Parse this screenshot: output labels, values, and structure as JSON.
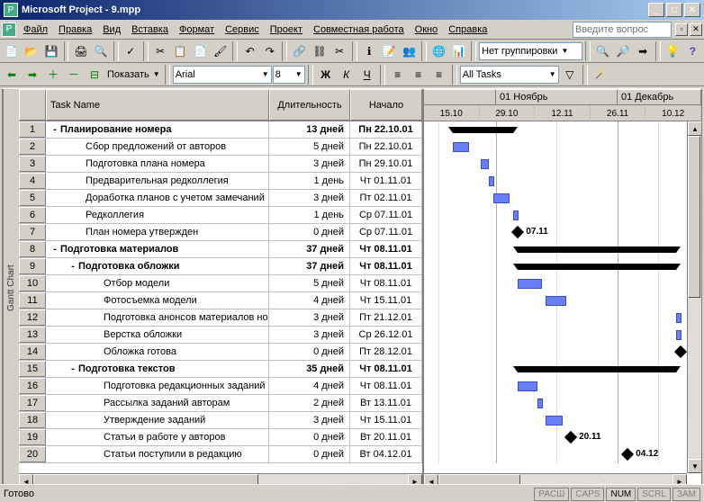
{
  "titlebar": {
    "app": "Microsoft Project",
    "file": "9.mpp"
  },
  "menu": {
    "file": "Файл",
    "edit": "Правка",
    "view": "Вид",
    "insert": "Вставка",
    "format": "Формат",
    "tools": "Сервис",
    "project": "Проект",
    "collab": "Совместная работа",
    "window": "Окно",
    "help": "Справка"
  },
  "question_placeholder": "Введите вопрос",
  "toolbar2": {
    "show_label": "Показать",
    "font": "Arial",
    "size": "8",
    "grouping": "Нет группировки",
    "filter": "All Tasks"
  },
  "view_name": "Gantt Chart",
  "columns": {
    "name": "Task Name",
    "duration": "Длительность",
    "start": "Начало"
  },
  "timeline": {
    "months": [
      "01 Ноябрь",
      "01 Декабрь"
    ],
    "days": [
      "15.10",
      "29.10",
      "12.11",
      "26.11",
      "10.12"
    ]
  },
  "tasks": [
    {
      "id": 1,
      "name": "Планирование номера",
      "dur": "13 дней",
      "start": "Пн 22.10.01",
      "type": "summary",
      "level": 0
    },
    {
      "id": 2,
      "name": "Сбор предложений от авторов",
      "dur": "5 дней",
      "start": "Пн 22.10.01",
      "type": "task",
      "level": 1
    },
    {
      "id": 3,
      "name": "Подготовка плана номера",
      "dur": "3 дней",
      "start": "Пн 29.10.01",
      "type": "task",
      "level": 1
    },
    {
      "id": 4,
      "name": "Предварительная редколлегия",
      "dur": "1 день",
      "start": "Чт 01.11.01",
      "type": "task",
      "level": 1
    },
    {
      "id": 5,
      "name": "Доработка планов с учетом замечаний",
      "dur": "3 дней",
      "start": "Пт 02.11.01",
      "type": "task",
      "level": 1
    },
    {
      "id": 6,
      "name": "Редколлегия",
      "dur": "1 день",
      "start": "Ср 07.11.01",
      "type": "task",
      "level": 1
    },
    {
      "id": 7,
      "name": "План номера утвержден",
      "dur": "0 дней",
      "start": "Ср 07.11.01",
      "type": "milestone",
      "level": 1,
      "label": "07.11"
    },
    {
      "id": 8,
      "name": "Подготовка материалов",
      "dur": "37 дней",
      "start": "Чт 08.11.01",
      "type": "summary",
      "level": 0
    },
    {
      "id": 9,
      "name": "Подготовка обложки",
      "dur": "37 дней",
      "start": "Чт 08.11.01",
      "type": "summary",
      "level": 1
    },
    {
      "id": 10,
      "name": "Отбор модели",
      "dur": "5 дней",
      "start": "Чт 08.11.01",
      "type": "task",
      "level": 2
    },
    {
      "id": 11,
      "name": "Фотосъемка модели",
      "dur": "4 дней",
      "start": "Чт 15.11.01",
      "type": "task",
      "level": 2
    },
    {
      "id": 12,
      "name": "Подготовка анонсов материалов номера для",
      "dur": "3 дней",
      "start": "Пт 21.12.01",
      "type": "task",
      "level": 2
    },
    {
      "id": 13,
      "name": "Верстка обложки",
      "dur": "3 дней",
      "start": "Ср 26.12.01",
      "type": "task",
      "level": 2
    },
    {
      "id": 14,
      "name": "Обложка готова",
      "dur": "0 дней",
      "start": "Пт 28.12.01",
      "type": "milestone",
      "level": 2
    },
    {
      "id": 15,
      "name": "Подготовка текстов",
      "dur": "35 дней",
      "start": "Чт 08.11.01",
      "type": "summary",
      "level": 1
    },
    {
      "id": 16,
      "name": "Подготовка редакционных заданий",
      "dur": "4 дней",
      "start": "Чт 08.11.01",
      "type": "task",
      "level": 2
    },
    {
      "id": 17,
      "name": "Рассылка заданий авторам",
      "dur": "2 дней",
      "start": "Вт 13.11.01",
      "type": "task",
      "level": 2
    },
    {
      "id": 18,
      "name": "Утверждение заданий",
      "dur": "3 дней",
      "start": "Чт 15.11.01",
      "type": "task",
      "level": 2
    },
    {
      "id": 19,
      "name": "Статьи в работе у авторов",
      "dur": "0 дней",
      "start": "Вт 20.11.01",
      "type": "milestone",
      "level": 2,
      "label": "20.11"
    },
    {
      "id": 20,
      "name": "Статьи поступили в редакцию",
      "dur": "0 дней",
      "start": "Вт 04.12.01",
      "type": "milestone",
      "level": 2,
      "label": "04.12"
    }
  ],
  "status": {
    "ready": "Готово",
    "cells": [
      "РАСШ",
      "CAPS",
      "NUM",
      "SCRL",
      "ЗАМ"
    ],
    "active": "NUM"
  },
  "chart_data": {
    "type": "gantt",
    "time_axis_start": "15.10.2001",
    "time_axis_end": "17.12.2001",
    "bars": [
      {
        "task_id": 1,
        "start": "22.10.01",
        "end": "07.11.01",
        "kind": "summary"
      },
      {
        "task_id": 2,
        "start": "22.10.01",
        "end": "26.10.01",
        "kind": "bar"
      },
      {
        "task_id": 3,
        "start": "29.10.01",
        "end": "31.10.01",
        "kind": "bar"
      },
      {
        "task_id": 4,
        "start": "01.11.01",
        "end": "01.11.01",
        "kind": "bar"
      },
      {
        "task_id": 5,
        "start": "02.11.01",
        "end": "06.11.01",
        "kind": "bar"
      },
      {
        "task_id": 6,
        "start": "07.11.01",
        "end": "07.11.01",
        "kind": "bar"
      },
      {
        "task_id": 7,
        "start": "07.11.01",
        "kind": "milestone",
        "label": "07.11"
      },
      {
        "task_id": 8,
        "start": "08.11.01",
        "end": "28.12.01",
        "kind": "summary"
      },
      {
        "task_id": 9,
        "start": "08.11.01",
        "end": "28.12.01",
        "kind": "summary"
      },
      {
        "task_id": 10,
        "start": "08.11.01",
        "end": "14.11.01",
        "kind": "bar"
      },
      {
        "task_id": 11,
        "start": "15.11.01",
        "end": "20.11.01",
        "kind": "bar"
      },
      {
        "task_id": 12,
        "start": "21.12.01",
        "end": "25.12.01",
        "kind": "bar"
      },
      {
        "task_id": 13,
        "start": "26.12.01",
        "end": "28.12.01",
        "kind": "bar"
      },
      {
        "task_id": 14,
        "start": "28.12.01",
        "kind": "milestone"
      },
      {
        "task_id": 15,
        "start": "08.11.01",
        "end": "26.12.01",
        "kind": "summary"
      },
      {
        "task_id": 16,
        "start": "08.11.01",
        "end": "13.11.01",
        "kind": "bar"
      },
      {
        "task_id": 17,
        "start": "13.11.01",
        "end": "14.11.01",
        "kind": "bar"
      },
      {
        "task_id": 18,
        "start": "15.11.01",
        "end": "19.11.01",
        "kind": "bar"
      },
      {
        "task_id": 19,
        "start": "20.11.01",
        "kind": "milestone",
        "label": "20.11"
      },
      {
        "task_id": 20,
        "start": "04.12.01",
        "kind": "milestone",
        "label": "04.12"
      }
    ],
    "links": [
      {
        "from": 2,
        "to": 3
      },
      {
        "from": 3,
        "to": 4
      },
      {
        "from": 4,
        "to": 5
      },
      {
        "from": 5,
        "to": 6
      },
      {
        "from": 6,
        "to": 7
      },
      {
        "from": 10,
        "to": 11
      },
      {
        "from": 16,
        "to": 17
      },
      {
        "from": 17,
        "to": 18
      },
      {
        "from": 18,
        "to": 19
      },
      {
        "from": 19,
        "to": 20
      }
    ]
  }
}
